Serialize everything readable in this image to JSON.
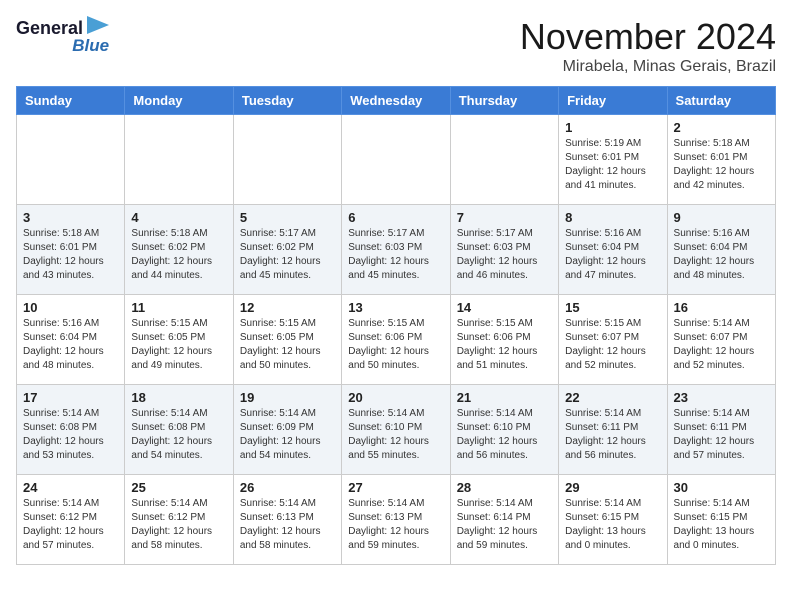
{
  "header": {
    "logo_line1": "General",
    "logo_line2": "Blue",
    "month": "November 2024",
    "location": "Mirabela, Minas Gerais, Brazil"
  },
  "weekdays": [
    "Sunday",
    "Monday",
    "Tuesday",
    "Wednesday",
    "Thursday",
    "Friday",
    "Saturday"
  ],
  "weeks": [
    [
      {
        "day": "",
        "info": ""
      },
      {
        "day": "",
        "info": ""
      },
      {
        "day": "",
        "info": ""
      },
      {
        "day": "",
        "info": ""
      },
      {
        "day": "",
        "info": ""
      },
      {
        "day": "1",
        "info": "Sunrise: 5:19 AM\nSunset: 6:01 PM\nDaylight: 12 hours\nand 41 minutes."
      },
      {
        "day": "2",
        "info": "Sunrise: 5:18 AM\nSunset: 6:01 PM\nDaylight: 12 hours\nand 42 minutes."
      }
    ],
    [
      {
        "day": "3",
        "info": "Sunrise: 5:18 AM\nSunset: 6:01 PM\nDaylight: 12 hours\nand 43 minutes."
      },
      {
        "day": "4",
        "info": "Sunrise: 5:18 AM\nSunset: 6:02 PM\nDaylight: 12 hours\nand 44 minutes."
      },
      {
        "day": "5",
        "info": "Sunrise: 5:17 AM\nSunset: 6:02 PM\nDaylight: 12 hours\nand 45 minutes."
      },
      {
        "day": "6",
        "info": "Sunrise: 5:17 AM\nSunset: 6:03 PM\nDaylight: 12 hours\nand 45 minutes."
      },
      {
        "day": "7",
        "info": "Sunrise: 5:17 AM\nSunset: 6:03 PM\nDaylight: 12 hours\nand 46 minutes."
      },
      {
        "day": "8",
        "info": "Sunrise: 5:16 AM\nSunset: 6:04 PM\nDaylight: 12 hours\nand 47 minutes."
      },
      {
        "day": "9",
        "info": "Sunrise: 5:16 AM\nSunset: 6:04 PM\nDaylight: 12 hours\nand 48 minutes."
      }
    ],
    [
      {
        "day": "10",
        "info": "Sunrise: 5:16 AM\nSunset: 6:04 PM\nDaylight: 12 hours\nand 48 minutes."
      },
      {
        "day": "11",
        "info": "Sunrise: 5:15 AM\nSunset: 6:05 PM\nDaylight: 12 hours\nand 49 minutes."
      },
      {
        "day": "12",
        "info": "Sunrise: 5:15 AM\nSunset: 6:05 PM\nDaylight: 12 hours\nand 50 minutes."
      },
      {
        "day": "13",
        "info": "Sunrise: 5:15 AM\nSunset: 6:06 PM\nDaylight: 12 hours\nand 50 minutes."
      },
      {
        "day": "14",
        "info": "Sunrise: 5:15 AM\nSunset: 6:06 PM\nDaylight: 12 hours\nand 51 minutes."
      },
      {
        "day": "15",
        "info": "Sunrise: 5:15 AM\nSunset: 6:07 PM\nDaylight: 12 hours\nand 52 minutes."
      },
      {
        "day": "16",
        "info": "Sunrise: 5:14 AM\nSunset: 6:07 PM\nDaylight: 12 hours\nand 52 minutes."
      }
    ],
    [
      {
        "day": "17",
        "info": "Sunrise: 5:14 AM\nSunset: 6:08 PM\nDaylight: 12 hours\nand 53 minutes."
      },
      {
        "day": "18",
        "info": "Sunrise: 5:14 AM\nSunset: 6:08 PM\nDaylight: 12 hours\nand 54 minutes."
      },
      {
        "day": "19",
        "info": "Sunrise: 5:14 AM\nSunset: 6:09 PM\nDaylight: 12 hours\nand 54 minutes."
      },
      {
        "day": "20",
        "info": "Sunrise: 5:14 AM\nSunset: 6:10 PM\nDaylight: 12 hours\nand 55 minutes."
      },
      {
        "day": "21",
        "info": "Sunrise: 5:14 AM\nSunset: 6:10 PM\nDaylight: 12 hours\nand 56 minutes."
      },
      {
        "day": "22",
        "info": "Sunrise: 5:14 AM\nSunset: 6:11 PM\nDaylight: 12 hours\nand 56 minutes."
      },
      {
        "day": "23",
        "info": "Sunrise: 5:14 AM\nSunset: 6:11 PM\nDaylight: 12 hours\nand 57 minutes."
      }
    ],
    [
      {
        "day": "24",
        "info": "Sunrise: 5:14 AM\nSunset: 6:12 PM\nDaylight: 12 hours\nand 57 minutes."
      },
      {
        "day": "25",
        "info": "Sunrise: 5:14 AM\nSunset: 6:12 PM\nDaylight: 12 hours\nand 58 minutes."
      },
      {
        "day": "26",
        "info": "Sunrise: 5:14 AM\nSunset: 6:13 PM\nDaylight: 12 hours\nand 58 minutes."
      },
      {
        "day": "27",
        "info": "Sunrise: 5:14 AM\nSunset: 6:13 PM\nDaylight: 12 hours\nand 59 minutes."
      },
      {
        "day": "28",
        "info": "Sunrise: 5:14 AM\nSunset: 6:14 PM\nDaylight: 12 hours\nand 59 minutes."
      },
      {
        "day": "29",
        "info": "Sunrise: 5:14 AM\nSunset: 6:15 PM\nDaylight: 13 hours\nand 0 minutes."
      },
      {
        "day": "30",
        "info": "Sunrise: 5:14 AM\nSunset: 6:15 PM\nDaylight: 13 hours\nand 0 minutes."
      }
    ]
  ]
}
